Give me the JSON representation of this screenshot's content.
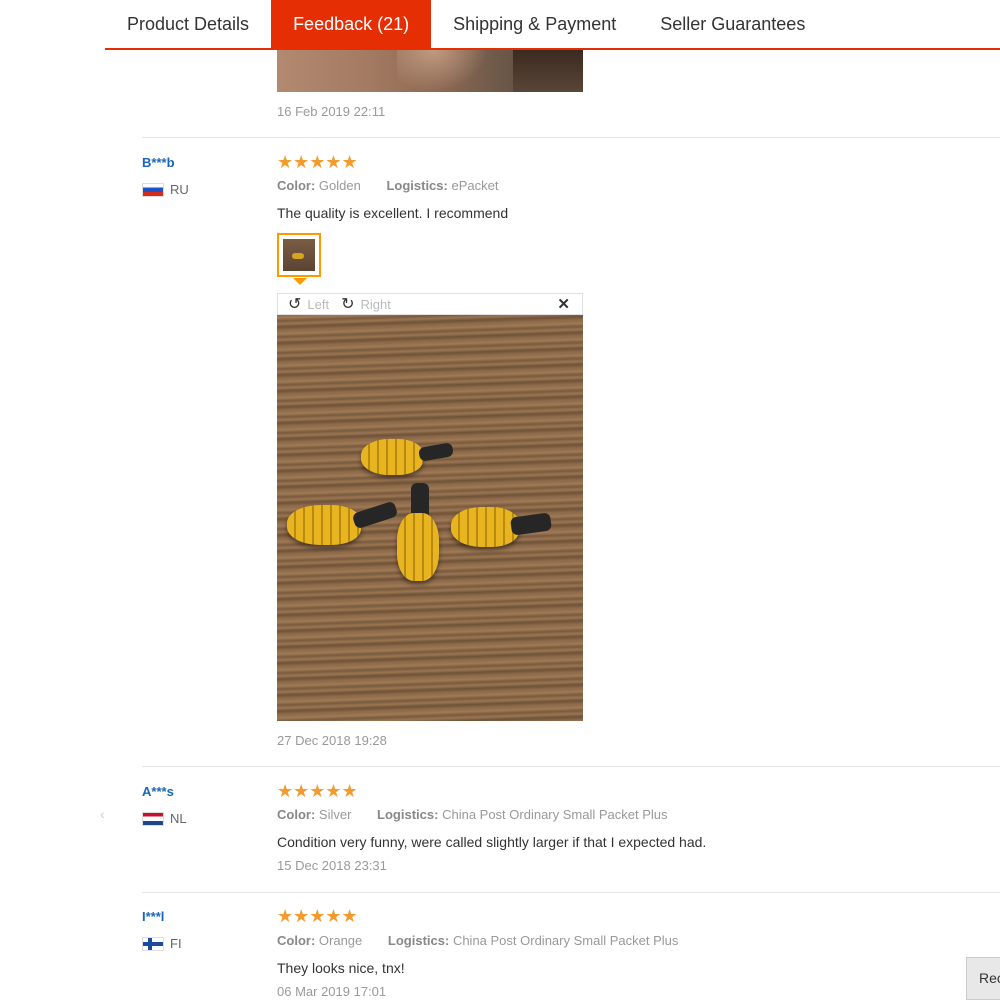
{
  "tabs": [
    {
      "label": "Product Details"
    },
    {
      "label": "Feedback (21)"
    },
    {
      "label": "Shipping & Payment"
    },
    {
      "label": "Seller Guarantees"
    }
  ],
  "prev_review": {
    "date": "16 Feb 2019 22:11"
  },
  "reviews": [
    {
      "user": "B***b",
      "country": "RU",
      "stars": "★★★★★",
      "color_key": "Color:",
      "color_val": "Golden",
      "logistics_key": "Logistics:",
      "logistics_val": "ePacket",
      "text": "The quality is excellent. I recommend",
      "date": "27 Dec 2018 19:28"
    },
    {
      "user": "A***s",
      "country": "NL",
      "stars": "★★★★★",
      "color_key": "Color:",
      "color_val": "Silver",
      "logistics_key": "Logistics:",
      "logistics_val": "China Post Ordinary Small Packet Plus",
      "text": "Condition very funny, were called slightly larger if that I expected had.",
      "date": "15 Dec 2018 23:31"
    },
    {
      "user": "I***l",
      "country": "FI",
      "stars": "★★★★★",
      "color_key": "Color:",
      "color_val": "Orange",
      "logistics_key": "Logistics:",
      "logistics_val": "China Post Ordinary Small Packet Plus",
      "text": "They looks nice, tnx!",
      "date": "06 Mar 2019 17:01"
    }
  ],
  "viewer": {
    "rotate_left_icon": "↺",
    "left_label": "Left",
    "rotate_right_icon": "↻",
    "right_label": "Right",
    "close_icon": "✕"
  },
  "scroll_hint": "‹",
  "recommend_button": "Rec",
  "colors": {
    "accent": "#e62e04",
    "star": "#f39b2e",
    "link": "#1a66b5"
  }
}
